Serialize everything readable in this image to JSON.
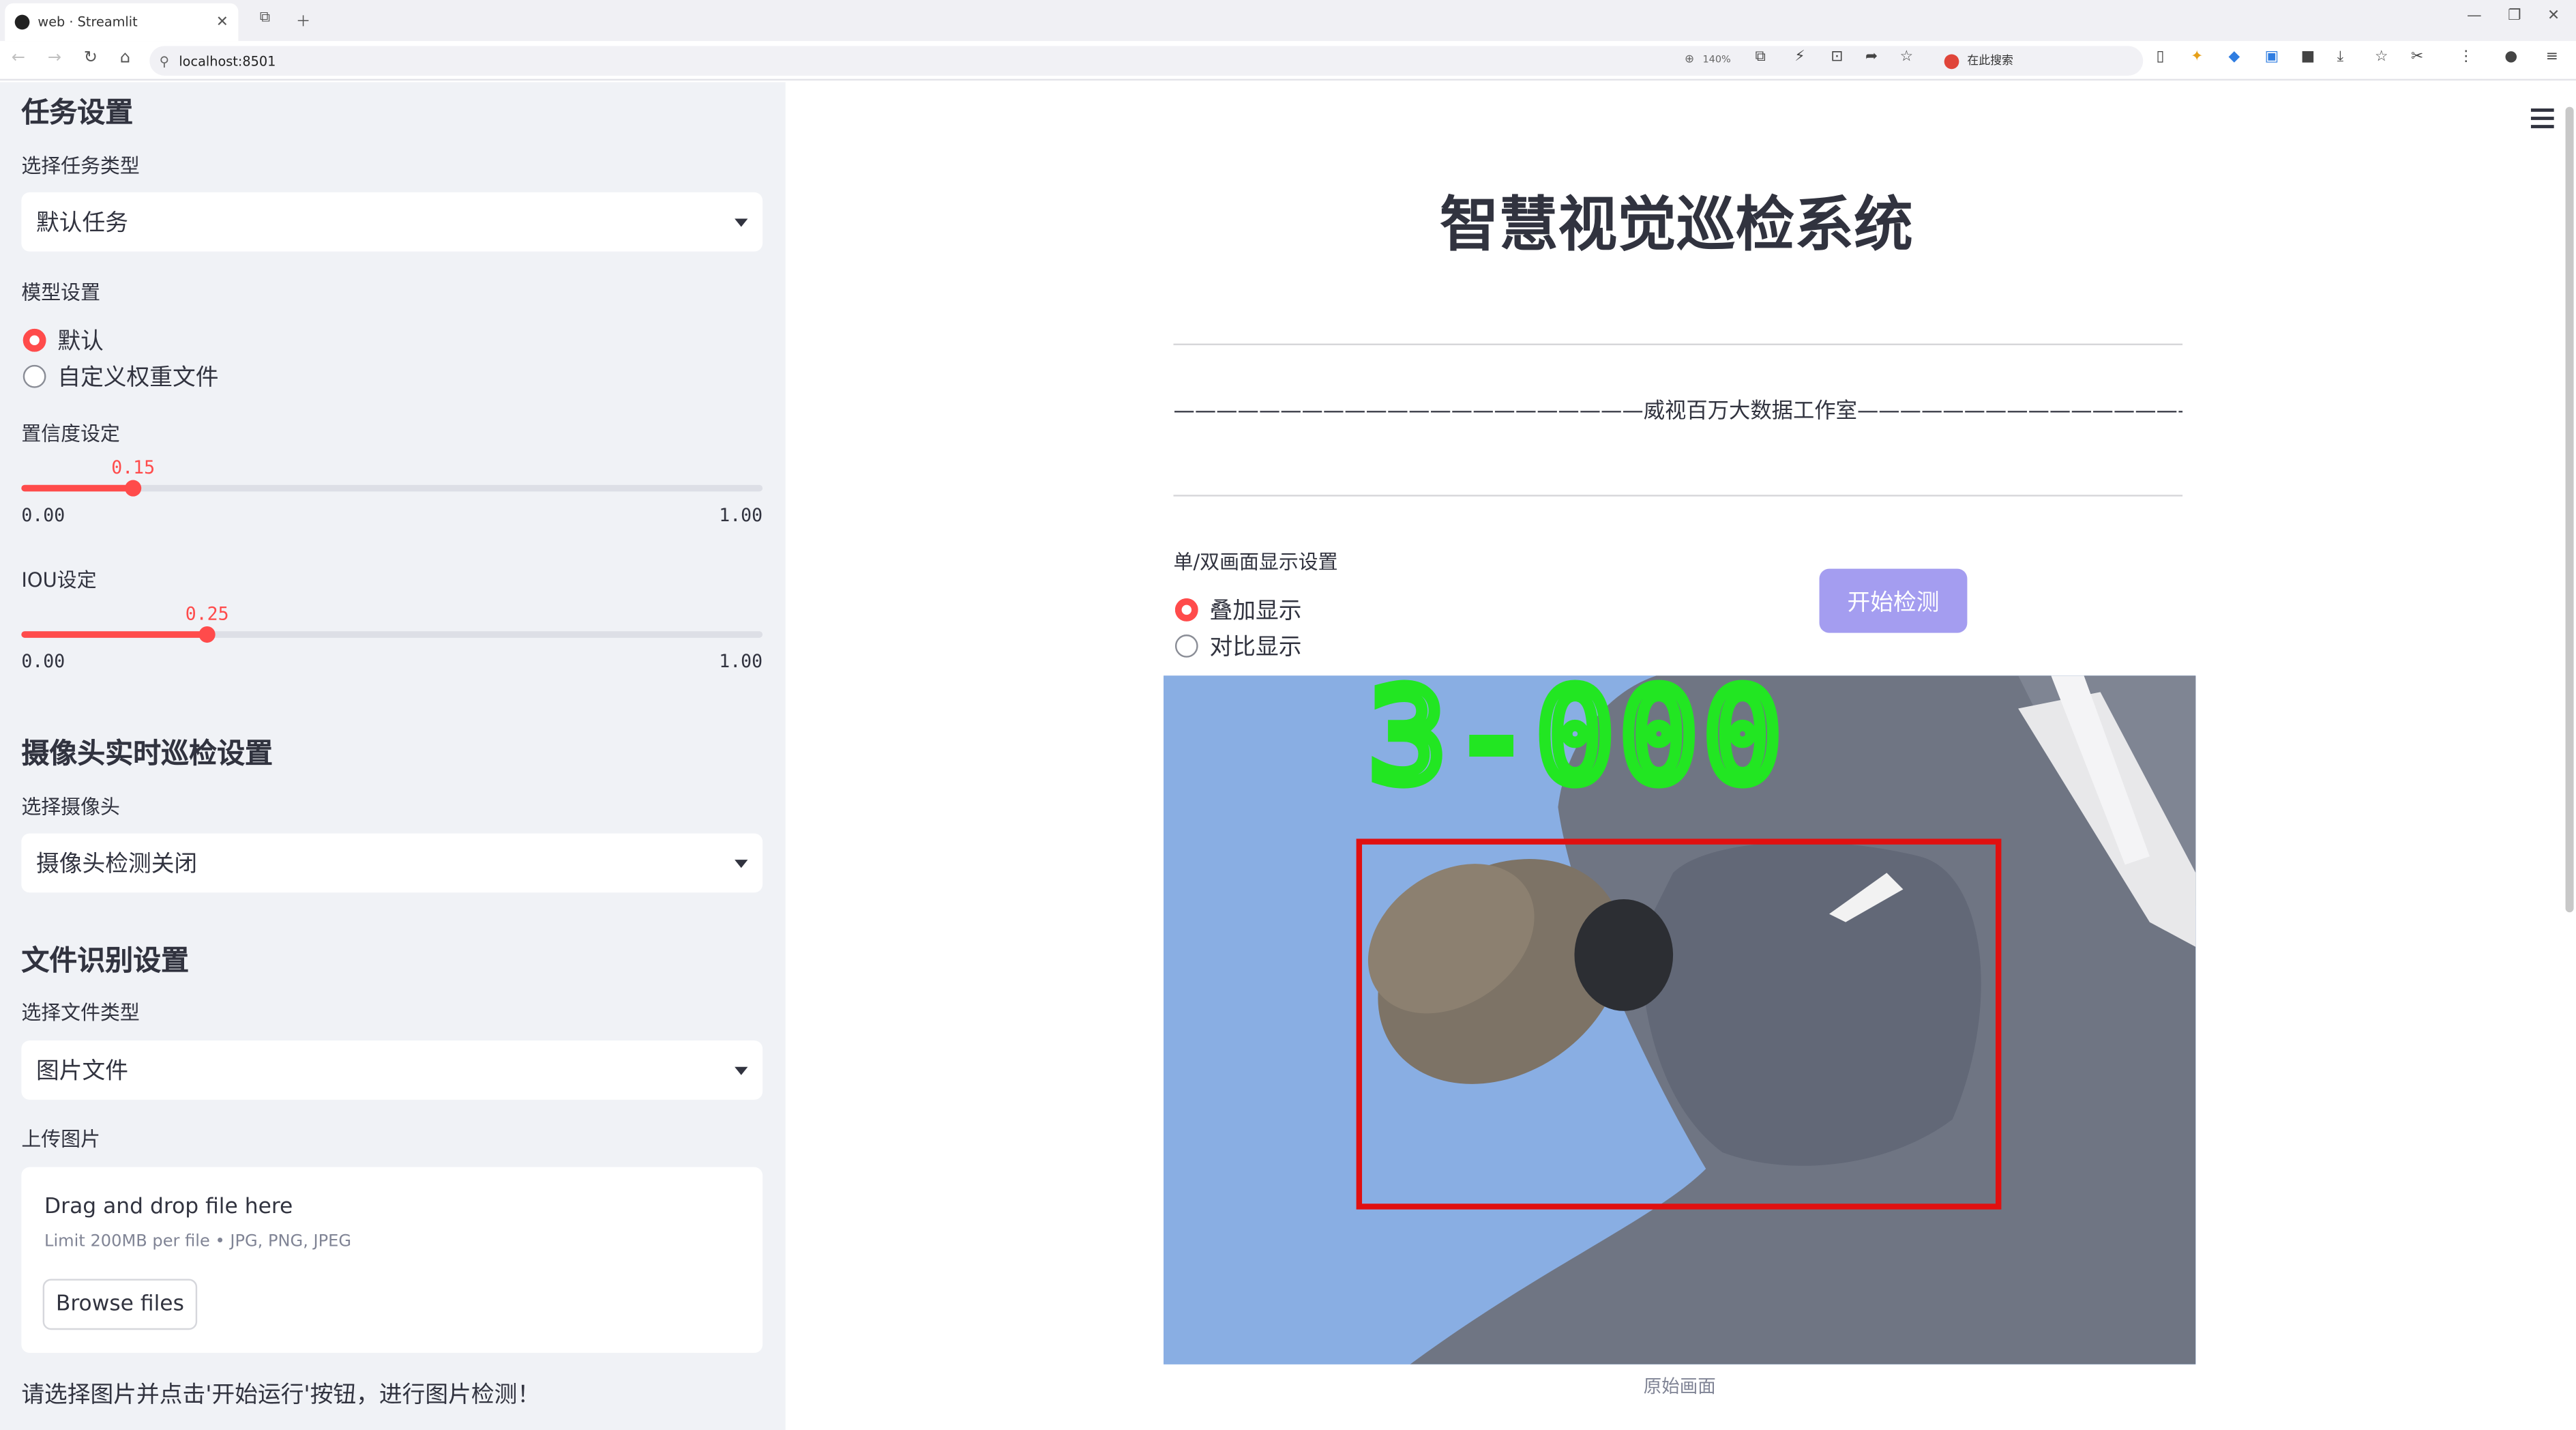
{
  "browser": {
    "tab_title": "web · Streamlit",
    "url": "localhost:8501",
    "zoom": "140%",
    "search_engine_label": "在此搜索"
  },
  "sidebar": {
    "task_section": {
      "heading": "任务设置",
      "select_label": "选择任务类型",
      "select_value": "默认任务"
    },
    "model_section": {
      "label": "模型设置",
      "options": [
        "默认",
        "自定义权重文件"
      ],
      "selected": "默认"
    },
    "confidence": {
      "label": "置信度设定",
      "value": "0.15",
      "fraction": 0.15,
      "min": "0.00",
      "max": "1.00"
    },
    "iou": {
      "label": "IOU设定",
      "value": "0.25",
      "fraction": 0.25,
      "min": "0.00",
      "max": "1.00"
    },
    "camera_section": {
      "heading": "摄像头实时巡检设置",
      "select_label": "选择摄像头",
      "select_value": "摄像头检测关闭"
    },
    "file_section": {
      "heading": "文件识别设置",
      "select_label": "选择文件类型",
      "select_value": "图片文件",
      "upload_label": "上传图片",
      "drop_title": "Drag and drop file here",
      "drop_limit": "Limit 200MB per file • JPG, PNG, JPEG",
      "browse_label": "Browse files"
    },
    "hint": "请选择图片并点击'开始运行'按钮，进行图片检测！"
  },
  "main": {
    "title": "智慧视觉巡检系统",
    "subtitle": "——————————————————————威视百万大数据工作室——————————————————————",
    "display_label": "单/双画面显示设置",
    "display_options": [
      "叠加显示",
      "对比显示"
    ],
    "display_selected": "叠加显示",
    "start_button": "开始检测",
    "overlay_text": "3-000",
    "caption": "原始画面"
  },
  "colors": {
    "accent": "#ff4b4b",
    "sidebar_bg": "#f0f2f6",
    "start_button": "#a49df0",
    "detection_box": "#e01010",
    "overlay_text": "#22e622"
  }
}
